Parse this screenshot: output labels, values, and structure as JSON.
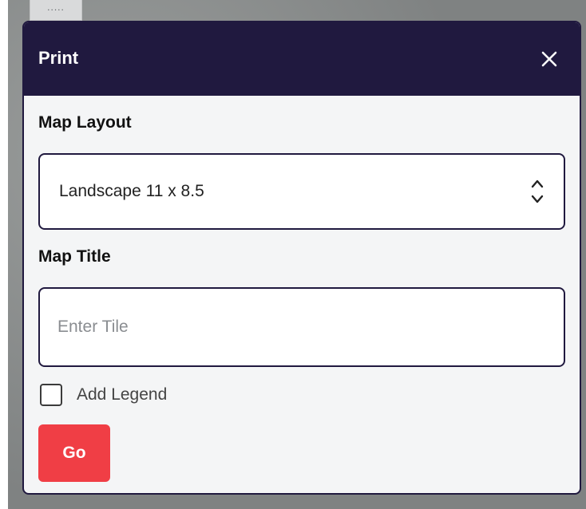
{
  "drag_handle": {
    "label": "....."
  },
  "dialog": {
    "title": "Print",
    "close_icon": "close-icon",
    "map_layout": {
      "label": "Map Layout",
      "selected": "Landscape 11 x 8.5"
    },
    "map_title": {
      "label": "Map Title",
      "value": "",
      "placeholder": "Enter Tile"
    },
    "add_legend": {
      "label": "Add Legend",
      "checked": false
    },
    "go_label": "Go"
  },
  "colors": {
    "header": "#20193f",
    "go_button": "#f03e45",
    "panel": "#f4f5f6"
  }
}
